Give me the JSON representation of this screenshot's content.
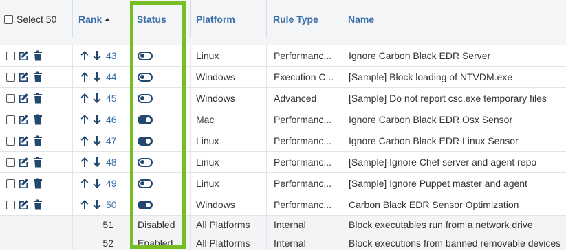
{
  "header": {
    "select_label": "Select 50",
    "rank_label": "Rank",
    "status_label": "Status",
    "platform_label": "Platform",
    "rule_type_label": "Rule Type",
    "name_label": "Name"
  },
  "rows": [
    {
      "rank": "43",
      "status": "off",
      "platform": "Linux",
      "rule_type": "Performanc...",
      "name": "Ignore Carbon Black EDR Server"
    },
    {
      "rank": "44",
      "status": "off",
      "platform": "Windows",
      "rule_type": "Execution C...",
      "name": "[Sample] Block loading of NTVDM.exe"
    },
    {
      "rank": "45",
      "status": "off",
      "platform": "Windows",
      "rule_type": "Advanced",
      "name": "[Sample] Do not report csc.exe temporary files"
    },
    {
      "rank": "46",
      "status": "on",
      "platform": "Mac",
      "rule_type": "Performanc...",
      "name": "Ignore Carbon Black EDR Osx Sensor"
    },
    {
      "rank": "47",
      "status": "on",
      "platform": "Linux",
      "rule_type": "Performanc...",
      "name": "Ignore Carbon Black EDR Linux Sensor"
    },
    {
      "rank": "48",
      "status": "off",
      "platform": "Linux",
      "rule_type": "Performanc...",
      "name": "[Sample] Ignore Chef server and agent repo"
    },
    {
      "rank": "49",
      "status": "off",
      "platform": "Linux",
      "rule_type": "Performanc...",
      "name": "[Sample] Ignore Puppet master and agent"
    },
    {
      "rank": "50",
      "status": "on",
      "platform": "Windows",
      "rule_type": "Performanc...",
      "name": "Carbon Black EDR Sensor Optimization"
    }
  ],
  "static_rows": [
    {
      "rank": "51",
      "status": "Disabled",
      "platform": "All Platforms",
      "rule_type": "Internal",
      "name": "Block executables run from a network drive"
    },
    {
      "rank": "52",
      "status": "Enabled",
      "platform": "All Platforms",
      "rule_type": "Internal",
      "name": "Block executions from banned removable devices"
    }
  ],
  "colors": {
    "link": "#3a6fa8",
    "toggle": "#23486e",
    "highlight": "#77bd24",
    "header_bg": "#f4f5f7"
  },
  "icons": {
    "edit": "edit-icon",
    "delete": "trash-icon",
    "move_up": "arrow-up-icon",
    "move_down": "arrow-down-icon",
    "sort": "sort-asc-icon"
  }
}
